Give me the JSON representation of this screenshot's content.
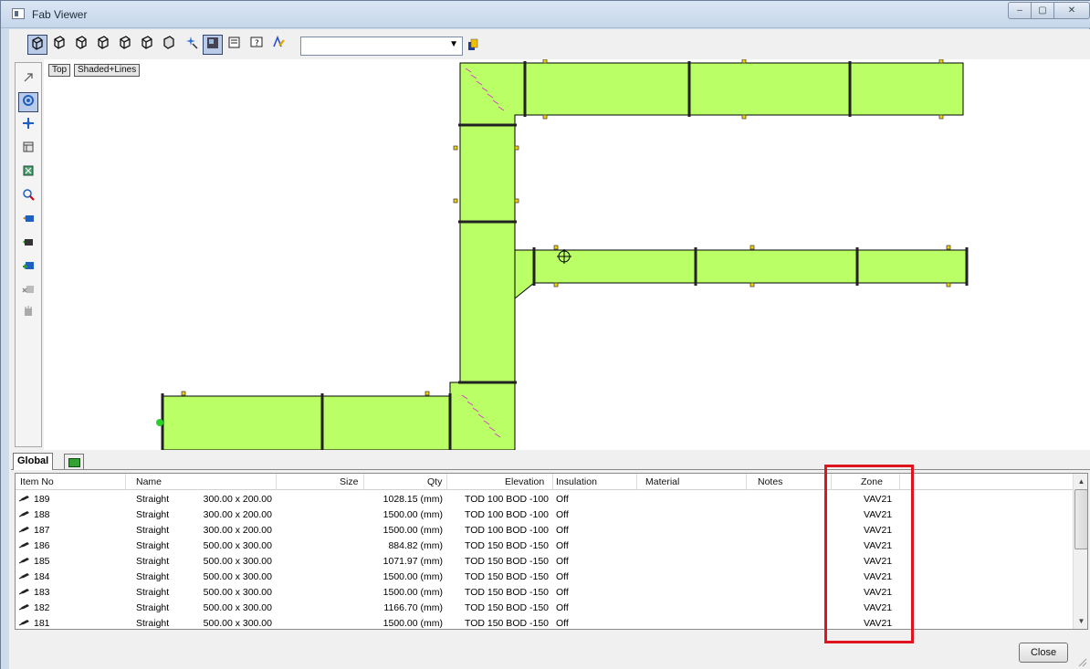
{
  "window": {
    "title": "Fab Viewer",
    "controls": {
      "minimize": "–",
      "maximize": "▢",
      "close": "✕"
    }
  },
  "toolbar": {
    "icons": [
      "view-iso-icon",
      "view-iso-2-icon",
      "view-iso-3-icon",
      "view-iso-4-icon",
      "view-iso-5-icon",
      "view-iso-6-icon",
      "view-iso-7-icon",
      "pointer-star-icon",
      "shaded-view-icon",
      "properties-icon",
      "help-icon",
      "paint-icon"
    ],
    "view_select_value": "",
    "layer_icon": "layer-icon"
  },
  "left_toolbar": {
    "icons": [
      "select-arrow-icon",
      "orbit-icon",
      "pan-icon",
      "grid-icon",
      "zoom-extents-icon",
      "zoom-window-icon",
      "camera-back-icon",
      "camera-front-icon",
      "add-component-icon",
      "remove-component-icon",
      "settings-small-icon"
    ]
  },
  "canvas": {
    "view_label": "Top",
    "render_mode": "Shaded+Lines",
    "duct_fill": "#bbff66",
    "duct_stroke": "#000000"
  },
  "tabs": {
    "global": "Global"
  },
  "table": {
    "columns": {
      "item_no": "Item No",
      "name": "Name",
      "size": "Size",
      "qty": "Qty",
      "elevation": "Elevation",
      "insulation": "Insulation",
      "material": "Material",
      "notes": "Notes",
      "zone": "Zone"
    },
    "rows": [
      {
        "item": "189",
        "name": "Straight",
        "size": "300.00 x 200.00",
        "qty": "1028.15 (mm)",
        "elevation": "TOD 100 BOD -100",
        "insulation": "Off",
        "zone": "VAV21"
      },
      {
        "item": "188",
        "name": "Straight",
        "size": "300.00 x 200.00",
        "qty": "1500.00 (mm)",
        "elevation": "TOD 100 BOD -100",
        "insulation": "Off",
        "zone": "VAV21"
      },
      {
        "item": "187",
        "name": "Straight",
        "size": "300.00 x 200.00",
        "qty": "1500.00 (mm)",
        "elevation": "TOD 100 BOD -100",
        "insulation": "Off",
        "zone": "VAV21"
      },
      {
        "item": "186",
        "name": "Straight",
        "size": "500.00 x 300.00",
        "qty": "884.82 (mm)",
        "elevation": "TOD 150 BOD -150",
        "insulation": "Off",
        "zone": "VAV21"
      },
      {
        "item": "185",
        "name": "Straight",
        "size": "500.00 x 300.00",
        "qty": "1071.97 (mm)",
        "elevation": "TOD 150 BOD -150",
        "insulation": "Off",
        "zone": "VAV21"
      },
      {
        "item": "184",
        "name": "Straight",
        "size": "500.00 x 300.00",
        "qty": "1500.00 (mm)",
        "elevation": "TOD 150 BOD -150",
        "insulation": "Off",
        "zone": "VAV21"
      },
      {
        "item": "183",
        "name": "Straight",
        "size": "500.00 x 300.00",
        "qty": "1500.00 (mm)",
        "elevation": "TOD 150 BOD -150",
        "insulation": "Off",
        "zone": "VAV21"
      },
      {
        "item": "182",
        "name": "Straight",
        "size": "500.00 x 300.00",
        "qty": "1166.70 (mm)",
        "elevation": "TOD 150 BOD -150",
        "insulation": "Off",
        "zone": "VAV21"
      },
      {
        "item": "181",
        "name": "Straight",
        "size": "500.00 x 300.00",
        "qty": "1500.00 (mm)",
        "elevation": "TOD 150 BOD -150",
        "insulation": "Off",
        "zone": "VAV21"
      }
    ]
  },
  "highlight_color": "#e0141e",
  "footer": {
    "close_label": "Close"
  }
}
